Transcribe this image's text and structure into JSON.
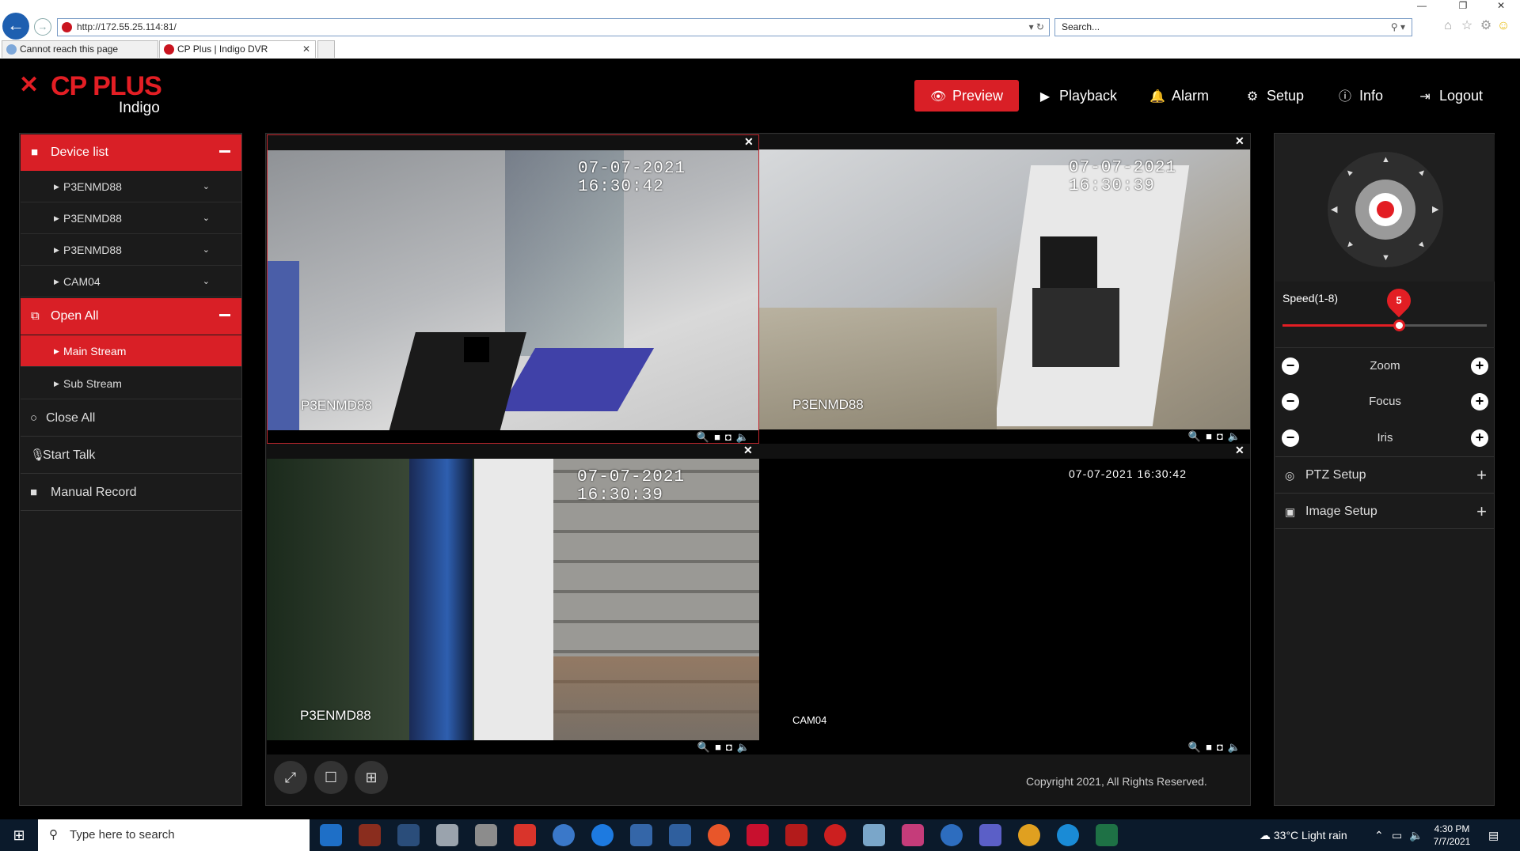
{
  "browser": {
    "url": "http://172.55.25.114:81/",
    "search_placeholder": "Search...",
    "tabs": [
      {
        "title": "Cannot reach this page"
      },
      {
        "title": "CP Plus | Indigo DVR"
      }
    ]
  },
  "app": {
    "brand": "CP PLUS",
    "sub_brand": "Indigo",
    "accent_color": "#d91f26",
    "nav": {
      "preview": "Preview",
      "playback": "Playback",
      "alarm": "Alarm",
      "setup": "Setup",
      "info": "Info",
      "logout": "Logout"
    }
  },
  "sidebar": {
    "device_list_label": "Device list",
    "devices": [
      "P3ENMD88",
      "P3ENMD88",
      "P3ENMD88",
      "CAM04"
    ],
    "open_all_label": "Open All",
    "streams": [
      "Main Stream",
      "Sub Stream"
    ],
    "close_all_label": "Close All",
    "start_talk_label": "Start Talk",
    "manual_record_label": "Manual Record"
  },
  "cameras": [
    {
      "timestamp": "07-07-2021 16:30:42",
      "name": "P3ENMD88"
    },
    {
      "timestamp": "07-07-2021 16:30:39",
      "name": "P3ENMD88"
    },
    {
      "timestamp": "07-07-2021 16:30:39",
      "name": "P3ENMD88"
    },
    {
      "timestamp": "07-07-2021 16:30:42",
      "name": "CAM04"
    }
  ],
  "footer": {
    "copyright": "Copyright 2021, All Rights Reserved."
  },
  "ptz": {
    "speed_label": "Speed(1-8)",
    "speed_value": "5",
    "speed_fraction": 0.57,
    "zoom_label": "Zoom",
    "focus_label": "Focus",
    "iris_label": "Iris",
    "ptz_setup_label": "PTZ Setup",
    "image_setup_label": "Image Setup"
  },
  "taskbar": {
    "search_placeholder": "Type here to search",
    "weather": "33°C  Light rain",
    "time": "4:30 PM",
    "date": "7/7/2021"
  }
}
